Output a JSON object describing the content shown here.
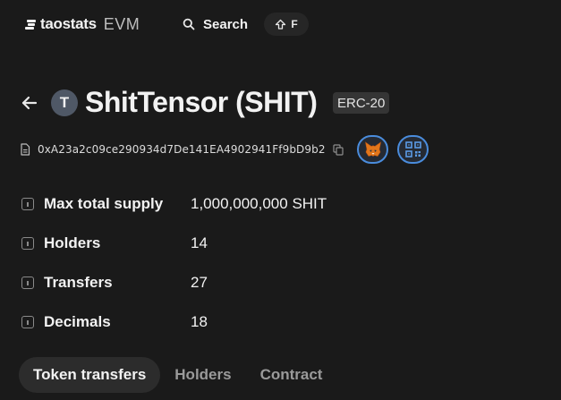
{
  "header": {
    "brand": "taostats",
    "network": "EVM",
    "search_label": "Search",
    "shortcut_key": "F"
  },
  "token": {
    "avatar_letter": "T",
    "name": "ShitTensor (SHIT)",
    "standard": "ERC-20",
    "address": "0xA23a2c09ce290934d7De141EA4902941Ff9bD9b2"
  },
  "properties": [
    {
      "label": "Max total supply",
      "value": "1,000,000,000 SHIT"
    },
    {
      "label": "Holders",
      "value": "14"
    },
    {
      "label": "Transfers",
      "value": "27"
    },
    {
      "label": "Decimals",
      "value": "18"
    }
  ],
  "tabs": [
    {
      "label": "Token transfers",
      "active": true
    },
    {
      "label": "Holders",
      "active": false
    },
    {
      "label": "Contract",
      "active": false
    }
  ],
  "colors": {
    "background": "#1a1a1a",
    "accent_border": "#4a8cdc",
    "qr_icon": "#5b9be6",
    "metamask_orange": "#e2761b"
  }
}
